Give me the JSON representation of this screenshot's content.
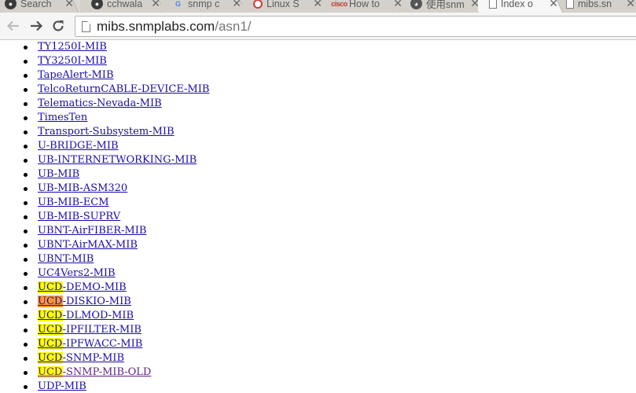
{
  "browser": {
    "tabs": [
      {
        "title": "Search",
        "icon": "github-icon",
        "active": false
      },
      {
        "title": "cchwala",
        "icon": "github-icon",
        "active": false
      },
      {
        "title": "snmp c",
        "icon": "google-icon",
        "active": false
      },
      {
        "title": "Linux S",
        "icon": "linux-icon",
        "active": false
      },
      {
        "title": "How to",
        "icon": "cisco-icon",
        "active": false
      },
      {
        "title": "使用snm",
        "icon": "user-icon",
        "active": false
      },
      {
        "title": "Index o",
        "icon": "page-icon",
        "active": true
      },
      {
        "title": "mibs.sn",
        "icon": "page-icon",
        "active": false
      }
    ],
    "address_bar": {
      "host": "mibs.snmplabs.com",
      "path": "/asn1/"
    }
  },
  "highlight_term": "UCD",
  "mib_list": [
    {
      "name": "TY1250I-MIB",
      "visited": false
    },
    {
      "name": "TY3250I-MIB",
      "visited": false
    },
    {
      "name": "TapeAlert-MIB",
      "visited": false
    },
    {
      "name": "TelcoReturnCABLE-DEVICE-MIB",
      "visited": false
    },
    {
      "name": "Telematics-Nevada-MIB",
      "visited": false
    },
    {
      "name": "TimesTen",
      "visited": false
    },
    {
      "name": "Transport-Subsystem-MIB",
      "visited": false
    },
    {
      "name": "U-BRIDGE-MIB",
      "visited": false
    },
    {
      "name": "UB-INTERNETWORKING-MIB",
      "visited": false
    },
    {
      "name": "UB-MIB",
      "visited": false
    },
    {
      "name": "UB-MIB-ASM320",
      "visited": false
    },
    {
      "name": "UB-MIB-ECM",
      "visited": false
    },
    {
      "name": "UB-MIB-SUPRV",
      "visited": false
    },
    {
      "name": "UBNT-AirFIBER-MIB",
      "visited": false
    },
    {
      "name": "UBNT-AirMAX-MIB",
      "visited": false
    },
    {
      "name": "UBNT-MIB",
      "visited": false
    },
    {
      "name": "UC4Vers2-MIB",
      "visited": false
    },
    {
      "name": "UCD-DEMO-MIB",
      "visited": false,
      "highlight": "match"
    },
    {
      "name": "UCD-DISKIO-MIB",
      "visited": false,
      "highlight": "current"
    },
    {
      "name": "UCD-DLMOD-MIB",
      "visited": false,
      "highlight": "match"
    },
    {
      "name": "UCD-IPFILTER-MIB",
      "visited": false,
      "highlight": "match"
    },
    {
      "name": "UCD-IPFWACC-MIB",
      "visited": false,
      "highlight": "match"
    },
    {
      "name": "UCD-SNMP-MIB",
      "visited": false,
      "highlight": "match"
    },
    {
      "name": "UCD-SNMP-MIB-OLD",
      "visited": true,
      "highlight": "match"
    },
    {
      "name": "UDP-MIB",
      "visited": false
    }
  ]
}
